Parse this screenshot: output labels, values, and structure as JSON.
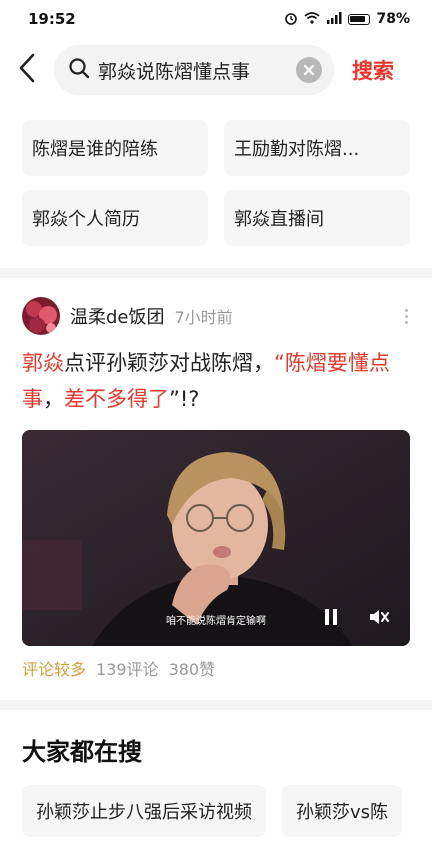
{
  "status_bar": {
    "time": "19:52",
    "battery": "78%",
    "icons": [
      "alarm-icon",
      "wifi-icon",
      "signal-icon",
      "battery-icon"
    ]
  },
  "search": {
    "query": "郭焱说陈熠懂点事",
    "submit_label": "搜索"
  },
  "suggestions": [
    {
      "label": "陈熠是谁的陪练"
    },
    {
      "label": "王励勤对陈熠..."
    },
    {
      "label": "郭焱个人简历"
    },
    {
      "label": "郭焱直播间"
    }
  ],
  "post": {
    "author": "温柔de饭团",
    "time": "7小时前",
    "title_parts": {
      "p1": "郭焱",
      "p2": "点评孙颖莎对战陈熠，",
      "p3": "“",
      "p4": "陈熠要懂点事",
      "p5": "，",
      "p6": "差不多得了",
      "p7": "”!?"
    },
    "video_caption": "咱不能说陈熠肯定输啊",
    "tag": "评论较多",
    "comments": "139评论",
    "likes": "380赞"
  },
  "hot": {
    "title": "大家都在搜",
    "items": [
      {
        "label": "孙颖莎止步八强后采访视频"
      },
      {
        "label": "孙颖莎vs陈"
      }
    ]
  },
  "colors": {
    "accent": "#e8372b",
    "tag": "#d4a03a"
  }
}
